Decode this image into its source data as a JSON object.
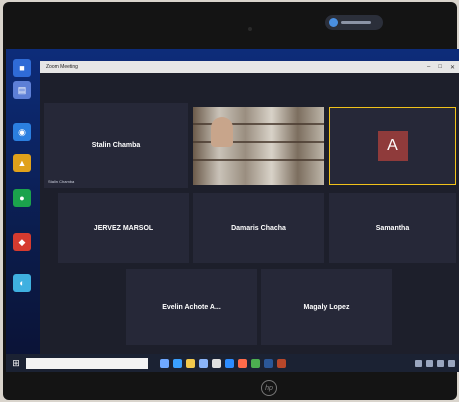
{
  "window": {
    "title": "Zoom Meeting"
  },
  "tiles": [
    {
      "display": "Stalin Chamba",
      "name": "Stalin Chamba"
    },
    {
      "display": "",
      "name": ""
    },
    {
      "display": "A",
      "name": ""
    },
    {
      "display": "JERVEZ MARSOL",
      "name": ""
    },
    {
      "display": "Damaris Chacha",
      "name": ""
    },
    {
      "display": "Samantha",
      "name": ""
    },
    {
      "display": "Evelin Achote A...",
      "name": ""
    },
    {
      "display": "Magaly Lopez",
      "name": ""
    }
  ],
  "taskbar": {
    "search_placeholder": ""
  },
  "colors": {
    "active_speaker": "#f0c21b",
    "avatar_bg": "#8f3b3b",
    "tile_bg": "#262838"
  },
  "icons": [
    "windows-start-icon",
    "hp-logo-icon"
  ]
}
